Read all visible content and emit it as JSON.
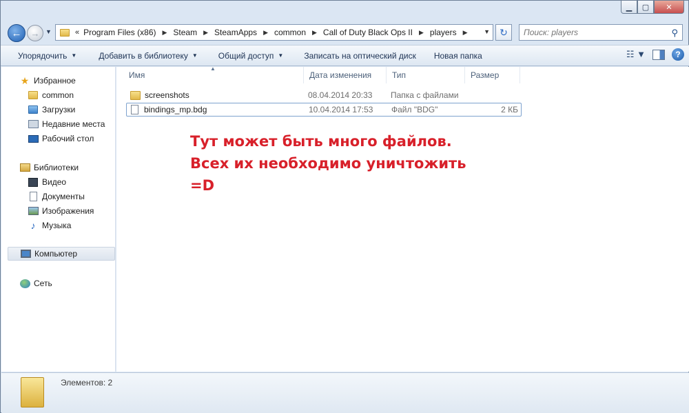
{
  "window": {
    "caption_buttons": [
      "minimize",
      "maximize",
      "close"
    ]
  },
  "nav": {
    "breadcrumbs": [
      "Program Files (x86)",
      "Steam",
      "SteamApps",
      "common",
      "Call of Duty Black Ops II",
      "players"
    ],
    "search_placeholder": "Поиск: players"
  },
  "toolbar": {
    "organize": "Упорядочить",
    "add_to_library": "Добавить в библиотеку",
    "share": "Общий доступ",
    "burn": "Записать на оптический диск",
    "new_folder": "Новая папка"
  },
  "sidebar": {
    "favorites": {
      "label": "Избранное",
      "items": [
        {
          "label": "common",
          "icon": "folder-icon"
        },
        {
          "label": "Загрузки",
          "icon": "downloads-icon"
        },
        {
          "label": "Недавние места",
          "icon": "recent-places-icon"
        },
        {
          "label": "Рабочий стол",
          "icon": "desktop-icon"
        }
      ]
    },
    "libraries": {
      "label": "Библиотеки",
      "items": [
        {
          "label": "Видео",
          "icon": "video-icon"
        },
        {
          "label": "Документы",
          "icon": "documents-icon"
        },
        {
          "label": "Изображения",
          "icon": "pictures-icon"
        },
        {
          "label": "Музыка",
          "icon": "music-icon"
        }
      ]
    },
    "computer": "Компьютер",
    "network": "Сеть"
  },
  "columns": {
    "name": "Имя",
    "date": "Дата изменения",
    "type": "Тип",
    "size": "Размер"
  },
  "files": [
    {
      "name": "screenshots",
      "date": "08.04.2014 20:33",
      "type": "Папка с файлами",
      "size": "",
      "icon": "folder-icon"
    },
    {
      "name": "bindings_mp.bdg",
      "date": "10.04.2014 17:53",
      "type": "Файл \"BDG\"",
      "size": "2 КБ",
      "icon": "file-icon"
    }
  ],
  "annotation": {
    "line1": "Тут может быть много файлов.",
    "line2": "Всех их необходимо уничтожить",
    "line3": "=D",
    "color": "#d8202a"
  },
  "status": {
    "count": "Элементов: 2"
  }
}
